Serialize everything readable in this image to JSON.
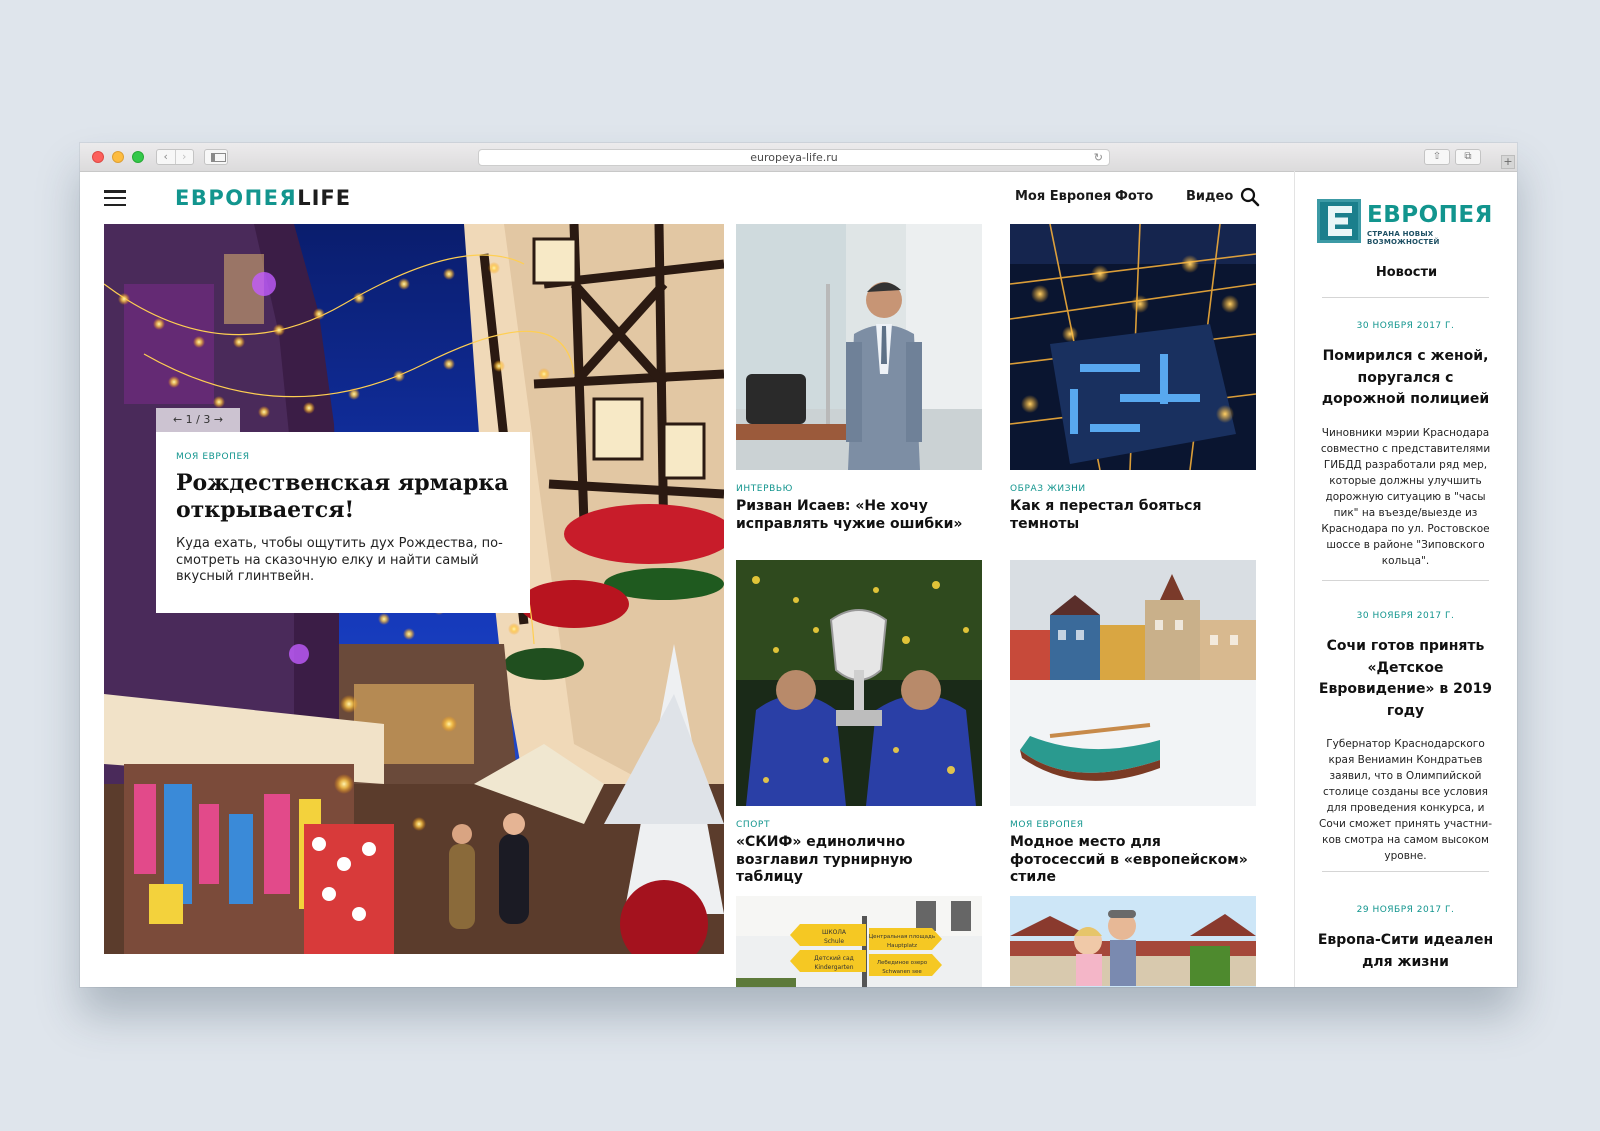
{
  "browser": {
    "url": "europeya-life.ru",
    "back_label": "‹",
    "forward_label": "›",
    "reload_label": "↻",
    "share_label": "⇧",
    "tabs_label": "⧉",
    "new_tab_label": "+"
  },
  "site": {
    "logo_part1": "ЕВРОПЕЯ",
    "logo_part2": "LIFE",
    "accent_color": "#12958e",
    "nav": [
      "Моя Европея",
      "Фото",
      "Видео"
    ]
  },
  "hero": {
    "pager": "← 1 / 3 →",
    "category": "МОЯ ЕВРОПЕЯ",
    "title": "Рождественская ярмарка открывается!",
    "lead": "Куда ехать, чтобы ощутить дух Рождества, по-смотреть на сказочную елку и найти самый вкусный глинтвейн."
  },
  "cards": [
    {
      "category": "ИНТЕРВЬЮ",
      "title": "Ризван Исаев: «Не хочу исправлять чужие ошибки»"
    },
    {
      "category": "ОБРАЗ ЖИЗНИ",
      "title": "Как я перестал бояться темноты"
    },
    {
      "category": "СПОРТ",
      "title": "«СКИФ» единолично возглавил турнирную таблицу"
    },
    {
      "category": "МОЯ ЕВРОПЕЯ",
      "title": "Модное место для фотосессий в «европейском» стиле"
    },
    {
      "category": "",
      "title": ""
    },
    {
      "category": "",
      "title": ""
    }
  ],
  "signs": {
    "s1": "ШКОЛА",
    "s1b": "Schule",
    "s2": "Центральная площадь",
    "s2b": "Hauptplatz",
    "s3": "Детский сад",
    "s3b": "Kindergarten",
    "s4": "Лебединое озеро",
    "s4b": "Schwanen see"
  },
  "news": {
    "brand_name": "ЕВРОПЕЯ",
    "brand_tagline": "СТРАНА НОВЫХ ВОЗМОЖНОСТЕЙ",
    "heading": "Новости",
    "items": [
      {
        "date": "30 НОЯБРЯ 2017 Г.",
        "title": "Помирился с женой, поругался с дорожной полицией",
        "text": "Чиновники мэрии Краснодара совместно с представителями ГИБДД разработали ряд мер, которые должны улучшить дорожную ситуацию в \"часы пик\" на въезде/выезде из Краснодара по ул. Ростовское шоссе в районе \"Зиповского кольца\"."
      },
      {
        "date": "30 НОЯБРЯ 2017 Г.",
        "title": "Сочи готов принять «Детское Евровидение» в 2019 году",
        "text": "Губернатор Краснодарского края Вениамин Кондратьев заявил, что в Олимпийской столице созданы все условия для проведения конкурса, и Сочи сможет принять участни-ков смотра на самом высоком уровне."
      },
      {
        "date": "29 НОЯБРЯ 2017 Г.",
        "title": "Европа-Сити идеален для жизни",
        "text": ""
      }
    ]
  }
}
